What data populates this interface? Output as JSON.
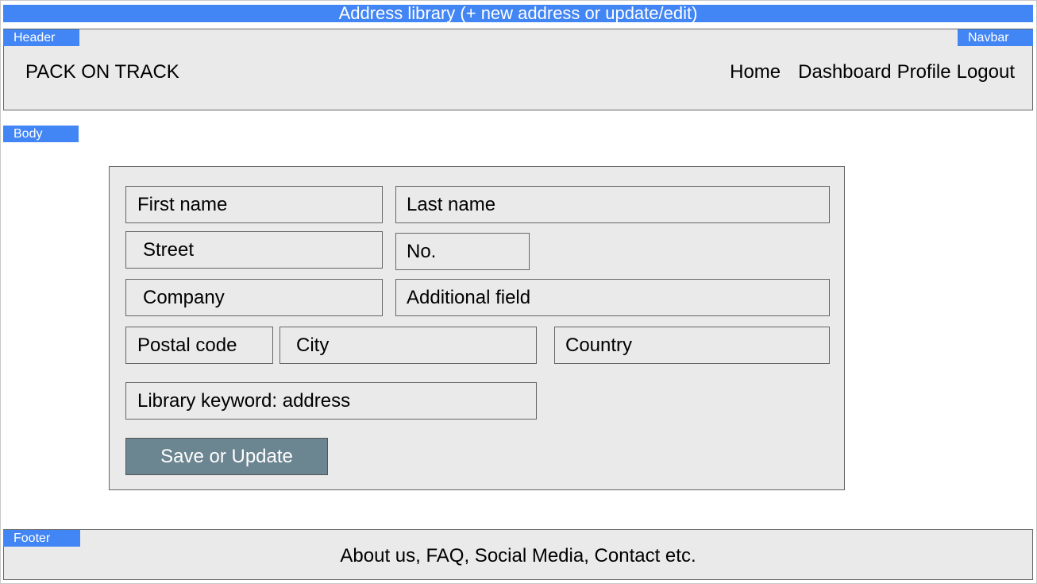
{
  "window": {
    "title": "Address library (+ new address or update/edit)"
  },
  "tags": {
    "header": "Header",
    "navbar": "Navbar",
    "body": "Body",
    "footer": "Footer"
  },
  "header": {
    "brand": "PACK ON TRACK",
    "nav": {
      "home": "Home",
      "dashboard": "Dashboard",
      "profile": "Profile",
      "logout": "Logout"
    }
  },
  "form": {
    "first_name": "First name",
    "last_name": "Last name",
    "street": "Street",
    "number": "No.",
    "company": "Company",
    "additional_field": "Additional field",
    "postal_code": "Postal code",
    "city": "City",
    "country": "Country",
    "library_keyword": "Library keyword: address",
    "save_label": "Save or Update"
  },
  "footer": {
    "links_text": "About us, FAQ, Social Media, Contact etc."
  },
  "colors": {
    "accent": "#4285f4",
    "panel": "#eaeaea",
    "button": "#6b8591"
  }
}
